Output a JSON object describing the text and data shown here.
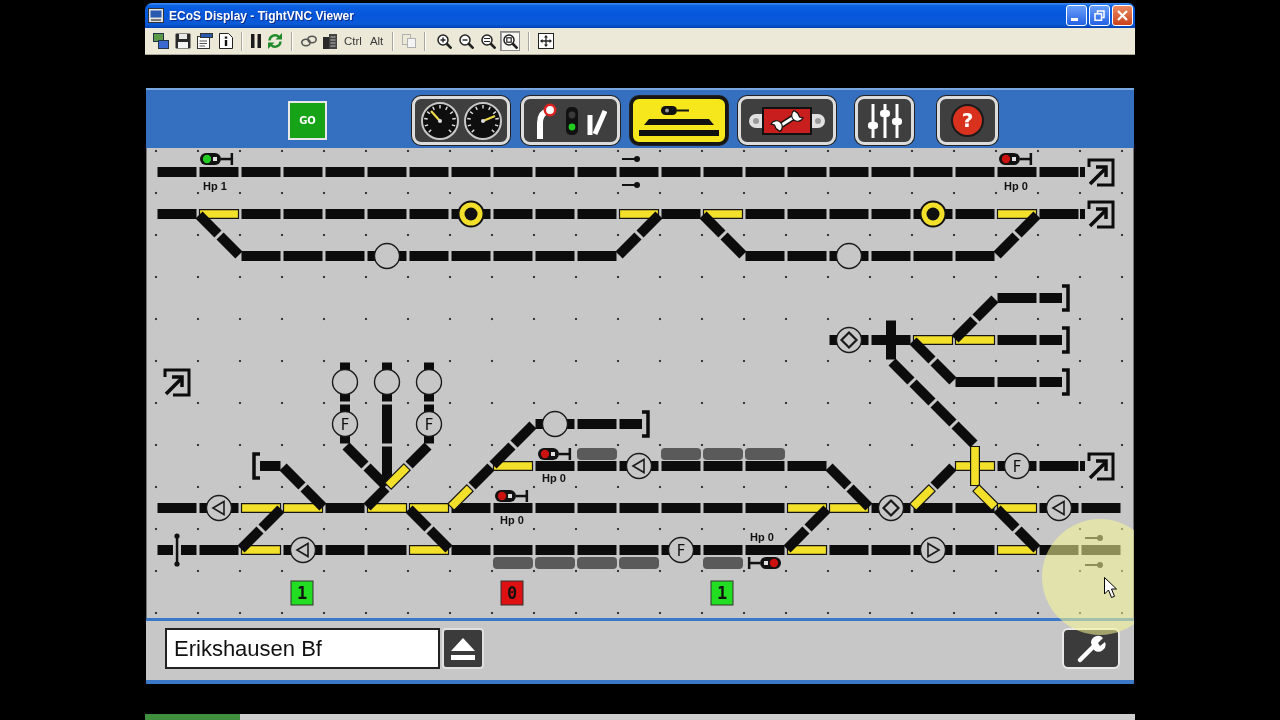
{
  "window": {
    "title": "ECoS Display - TightVNC Viewer"
  },
  "toolbar": {
    "keys": [
      {
        "label": "Ctrl"
      },
      {
        "label": "Alt"
      }
    ],
    "clipboard": {
      "disabled": true
    },
    "zoom": [
      {
        "kind": "zoom_in",
        "selected": false
      },
      {
        "kind": "zoom_out",
        "selected": false
      },
      {
        "kind": "actual_size",
        "selected": false
      },
      {
        "kind": "fit",
        "selected": true
      }
    ]
  },
  "header": {
    "go_button": {
      "label": "GO"
    },
    "tabs": [
      {
        "kind": "gauges",
        "selected": false
      },
      {
        "kind": "accessories",
        "selected": false
      },
      {
        "kind": "layout",
        "selected": true
      },
      {
        "kind": "loco_service",
        "selected": false
      },
      {
        "kind": "controls",
        "selected": false
      },
      {
        "kind": "help",
        "label": "?",
        "selected": false
      }
    ]
  },
  "track_diagram": {
    "signals": [
      {
        "label": "Hp 1",
        "color": "#22cc22"
      },
      {
        "label": "Hp 0",
        "color": "#cc1111"
      },
      {
        "label": "Hp 0",
        "color": "#cc1111"
      },
      {
        "label": "Hp 0",
        "color": "#cc1111"
      },
      {
        "label": "Hp 0",
        "color": "#cc1111"
      }
    ],
    "segments": [
      {
        "on": false
      },
      {
        "on": false
      },
      {
        "on": false
      },
      {
        "on": false
      },
      {
        "on": false
      },
      {
        "on": false
      },
      {
        "on": false
      },
      {
        "on": false
      },
      {
        "on": false
      },
      {
        "on": false
      },
      {
        "on": false
      },
      {
        "on": false
      },
      {
        "on": false
      },
      {
        "on": false
      },
      {
        "on": false
      },
      {
        "on": false
      },
      {
        "on": false
      },
      {
        "on": false
      },
      {
        "on": false
      },
      {
        "on": false
      },
      {
        "on": false
      },
      {
        "on": false
      },
      {
        "on": false
      },
      {
        "on": true
      },
      {
        "on": false
      },
      {
        "on": false
      },
      {
        "on": false
      },
      {
        "on": false
      },
      {
        "on": false
      },
      {
        "on": false
      },
      {
        "on": false
      },
      {
        "on": false
      },
      {
        "on": false
      },
      {
        "on": false
      },
      {
        "on": false
      },
      {
        "on": true
      },
      {
        "on": false
      },
      {
        "on": false
      },
      {
        "on": true
      },
      {
        "on": false
      },
      {
        "on": false
      },
      {
        "on": false
      },
      {
        "on": false
      },
      {
        "on": false
      },
      {
        "on": false
      },
      {
        "on": false
      },
      {
        "on": false
      },
      {
        "on": true
      },
      {
        "on": false
      },
      {
        "on": false
      },
      {
        "on": false
      },
      {
        "on": false
      },
      {
        "on": false
      },
      {
        "on": false
      },
      {
        "on": false
      },
      {
        "on": false
      },
      {
        "on": false
      },
      {
        "on": false
      },
      {
        "on": false
      },
      {
        "on": false
      },
      {
        "on": false
      },
      {
        "on": false
      },
      {
        "on": false
      },
      {
        "on": false
      },
      {
        "on": false
      },
      {
        "on": false
      },
      {
        "on": false
      },
      {
        "on": false
      },
      {
        "on": false
      },
      {
        "on": false
      },
      {
        "on": false
      },
      {
        "on": false
      },
      {
        "on": false
      },
      {
        "on": false
      },
      {
        "on": false
      },
      {
        "on": false
      },
      {
        "on": false
      },
      {
        "on": false
      },
      {
        "on": true
      },
      {
        "on": false
      },
      {
        "on": true
      },
      {
        "on": false
      },
      {
        "on": false
      },
      {
        "on": false
      },
      {
        "on": false
      },
      {
        "on": false
      },
      {
        "on": false
      },
      {
        "on": false
      },
      {
        "on": false
      },
      {
        "on": false
      },
      {
        "on": false
      },
      {
        "on": false
      },
      {
        "on": false
      },
      {
        "on": false
      },
      {
        "on": false
      },
      {
        "on": false
      },
      {
        "on": false
      },
      {
        "on": false
      },
      {
        "on": false
      },
      {
        "on": false
      },
      {
        "on": false
      },
      {
        "on": false
      },
      {
        "on": false
      },
      {
        "on": false
      },
      {
        "on": false
      },
      {
        "on": false
      },
      {
        "on": false
      },
      {
        "on": false
      },
      {
        "on": false
      },
      {
        "on": false
      },
      {
        "on": false
      },
      {
        "on": false
      },
      {
        "on": false
      },
      {
        "on": true
      },
      {
        "on": false
      },
      {
        "on": false
      },
      {
        "on": true
      },
      {
        "on": false
      },
      {
        "on": false
      },
      {
        "on": false
      },
      {
        "on": false
      },
      {
        "on": false
      },
      {
        "on": false
      },
      {
        "on": false
      },
      {
        "on": false
      },
      {
        "on": false
      },
      {
        "on": false
      },
      {
        "on": false
      },
      {
        "on": true
      },
      {
        "on": true
      },
      {
        "on": false
      },
      {
        "on": false
      },
      {
        "on": false
      },
      {
        "on": false
      },
      {
        "on": false
      },
      {
        "on": false
      },
      {
        "on": true
      },
      {
        "on": false
      },
      {
        "on": true
      },
      {
        "on": false
      },
      {
        "on": false
      },
      {
        "on": true
      },
      {
        "on": false
      },
      {
        "on": true
      },
      {
        "on": false
      },
      {
        "on": false
      },
      {
        "on": true
      },
      {
        "on": false
      },
      {
        "on": false
      },
      {
        "on": false
      },
      {
        "on": false
      },
      {
        "on": false
      },
      {
        "on": false
      },
      {
        "on": false
      },
      {
        "on": true
      },
      {
        "on": false
      },
      {
        "on": true
      },
      {
        "on": false
      },
      {
        "on": false
      },
      {
        "on": false
      },
      {
        "on": false
      },
      {
        "on": true
      },
      {
        "on": false
      },
      {
        "on": true
      },
      {
        "on": true
      },
      {
        "on": false
      },
      {
        "on": false
      },
      {
        "on": false
      },
      {
        "on": false
      },
      {
        "on": false
      },
      {
        "on": false
      },
      {
        "on": false
      },
      {
        "on": true
      },
      {
        "on": false
      },
      {
        "on": false
      },
      {
        "on": false
      },
      {
        "on": false
      },
      {
        "on": false
      },
      {
        "on": true
      },
      {
        "on": false
      },
      {
        "on": false
      },
      {
        "on": false
      },
      {
        "on": false
      },
      {
        "on": false
      },
      {
        "on": false
      },
      {
        "on": false
      },
      {
        "on": false
      },
      {
        "on": false
      },
      {
        "on": false
      },
      {
        "on": true
      },
      {
        "on": false
      },
      {
        "on": false
      },
      {
        "on": false
      },
      {
        "on": false
      },
      {
        "on": false
      },
      {
        "on": false
      },
      {
        "on": true
      },
      {
        "on": false
      },
      {
        "on": false
      },
      {
        "on": false
      }
    ],
    "accessories": [
      {
        "kind": "circle",
        "on": true
      },
      {
        "kind": "circle",
        "on": true
      },
      {
        "kind": "circle",
        "on": false
      },
      {
        "kind": "circle",
        "on": false
      },
      {
        "kind": "diamond",
        "on": false
      },
      {
        "kind": "circle",
        "on": false
      },
      {
        "kind": "circle",
        "on": false
      },
      {
        "kind": "circle",
        "on": false
      },
      {
        "kind": "letter",
        "label": "F",
        "on": false
      },
      {
        "kind": "letter",
        "label": "F",
        "on": false
      },
      {
        "kind": "circle",
        "on": false
      },
      {
        "kind": "triangle_left",
        "on": false
      },
      {
        "kind": "letter",
        "label": "F",
        "on": false
      },
      {
        "kind": "triangle_left",
        "on": false
      },
      {
        "kind": "diamond",
        "on": false
      },
      {
        "kind": "triangle_left",
        "on": false
      },
      {
        "kind": "triangle_left",
        "on": false
      },
      {
        "kind": "letter",
        "label": "F",
        "on": false
      },
      {
        "kind": "triangle_right",
        "on": false
      }
    ],
    "occupancy_bars": [
      {
        "occupied": true
      },
      {
        "occupied": true
      },
      {
        "occupied": true
      },
      {
        "occupied": true
      },
      {
        "occupied": true
      },
      {
        "occupied": true
      },
      {
        "occupied": true
      },
      {
        "occupied": true
      },
      {
        "occupied": true
      }
    ],
    "counters": [
      {
        "value": "1",
        "color": "#22dd22"
      },
      {
        "value": "0",
        "color": "#dd1111"
      },
      {
        "value": "1",
        "color": "#22dd22"
      }
    ]
  },
  "station_field": {
    "value": "Erikshausen Bf"
  }
}
